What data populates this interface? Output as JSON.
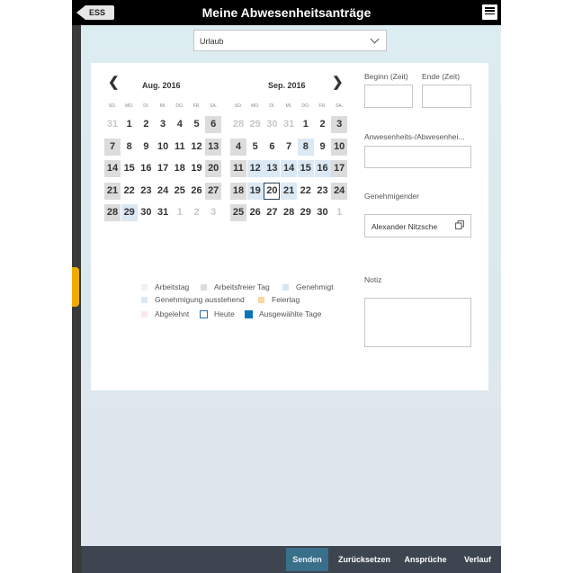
{
  "header": {
    "back_label": "ESS",
    "title": "Meine Abwesenheitsanträge"
  },
  "absence_type": {
    "selected": "Urlaub"
  },
  "calendar": {
    "weekdays": [
      "SO.",
      "MO.",
      "DI.",
      "MI.",
      "DO.",
      "FR.",
      "SA."
    ],
    "months": [
      {
        "name": "Aug. 2016",
        "rows": [
          [
            {
              "d": "31",
              "t": "other"
            },
            {
              "d": "1"
            },
            {
              "d": "2"
            },
            {
              "d": "3"
            },
            {
              "d": "4"
            },
            {
              "d": "5"
            },
            {
              "d": "6",
              "t": "we"
            }
          ],
          [
            {
              "d": "7",
              "t": "we"
            },
            {
              "d": "8"
            },
            {
              "d": "9"
            },
            {
              "d": "10"
            },
            {
              "d": "11"
            },
            {
              "d": "12"
            },
            {
              "d": "13",
              "t": "we"
            }
          ],
          [
            {
              "d": "14",
              "t": "we"
            },
            {
              "d": "15"
            },
            {
              "d": "16"
            },
            {
              "d": "17"
            },
            {
              "d": "18"
            },
            {
              "d": "19"
            },
            {
              "d": "20",
              "t": "we"
            }
          ],
          [
            {
              "d": "21",
              "t": "we"
            },
            {
              "d": "22"
            },
            {
              "d": "23"
            },
            {
              "d": "24"
            },
            {
              "d": "25"
            },
            {
              "d": "26"
            },
            {
              "d": "27",
              "t": "we"
            }
          ],
          [
            {
              "d": "28",
              "t": "we"
            },
            {
              "d": "29",
              "t": "app"
            },
            {
              "d": "30"
            },
            {
              "d": "31"
            },
            {
              "d": "1",
              "t": "other"
            },
            {
              "d": "2",
              "t": "other"
            },
            {
              "d": "3",
              "t": "other"
            }
          ]
        ]
      },
      {
        "name": "Sep. 2016",
        "rows": [
          [
            {
              "d": "28",
              "t": "other"
            },
            {
              "d": "29",
              "t": "other"
            },
            {
              "d": "30",
              "t": "other"
            },
            {
              "d": "31",
              "t": "other"
            },
            {
              "d": "1"
            },
            {
              "d": "2"
            },
            {
              "d": "3",
              "t": "we"
            }
          ],
          [
            {
              "d": "4",
              "t": "we"
            },
            {
              "d": "5"
            },
            {
              "d": "6"
            },
            {
              "d": "7"
            },
            {
              "d": "8",
              "t": "app"
            },
            {
              "d": "9"
            },
            {
              "d": "10",
              "t": "we"
            }
          ],
          [
            {
              "d": "11",
              "t": "we"
            },
            {
              "d": "12",
              "t": "app"
            },
            {
              "d": "13",
              "t": "app"
            },
            {
              "d": "14",
              "t": "app"
            },
            {
              "d": "15",
              "t": "app"
            },
            {
              "d": "16",
              "t": "app"
            },
            {
              "d": "17",
              "t": "we"
            }
          ],
          [
            {
              "d": "18",
              "t": "we"
            },
            {
              "d": "19",
              "t": "app"
            },
            {
              "d": "20",
              "t": "today"
            },
            {
              "d": "21",
              "t": "app"
            },
            {
              "d": "22"
            },
            {
              "d": "23"
            },
            {
              "d": "24",
              "t": "we"
            }
          ],
          [
            {
              "d": "25",
              "t": "we"
            },
            {
              "d": "26"
            },
            {
              "d": "27"
            },
            {
              "d": "28"
            },
            {
              "d": "29"
            },
            {
              "d": "30"
            },
            {
              "d": "1",
              "t": "other"
            }
          ]
        ]
      }
    ]
  },
  "legend": {
    "arbeitstag": "Arbeitstag",
    "arbeitsfrei": "Arbeitsfreier Tag",
    "genehmigt": "Genehmigt",
    "ausstehend": "Genehmigung ausstehend",
    "feiertag": "Feiertag",
    "abgelehnt": "Abgelehnt",
    "heute": "Heute",
    "ausgewaehlt": "Ausgewählte Tage",
    "colors": {
      "arbeitstag": "#f2f2f2",
      "arbeitsfrei": "#dcdcdc",
      "genehmigt": "#d4e6f5",
      "ausstehend": "#dceaf6",
      "feiertag": "#f9d8a0",
      "abgelehnt": "#fbe8ea",
      "heute": "#2a6fa8",
      "ausgewaehlt": "#0a74b9"
    }
  },
  "form": {
    "begin_label": "Beginn (Zeit)",
    "end_label": "Ende (Zeit)",
    "type_label": "Anwesenheits-/Abwesenhei...",
    "approver_label": "Genehmigender",
    "approver_value": "Alexander Nitzsche",
    "note_label": "Notiz"
  },
  "footer": {
    "send": "Senden",
    "reset": "Zurücksetzen",
    "claims": "Ansprüche",
    "history": "Verlauf"
  }
}
